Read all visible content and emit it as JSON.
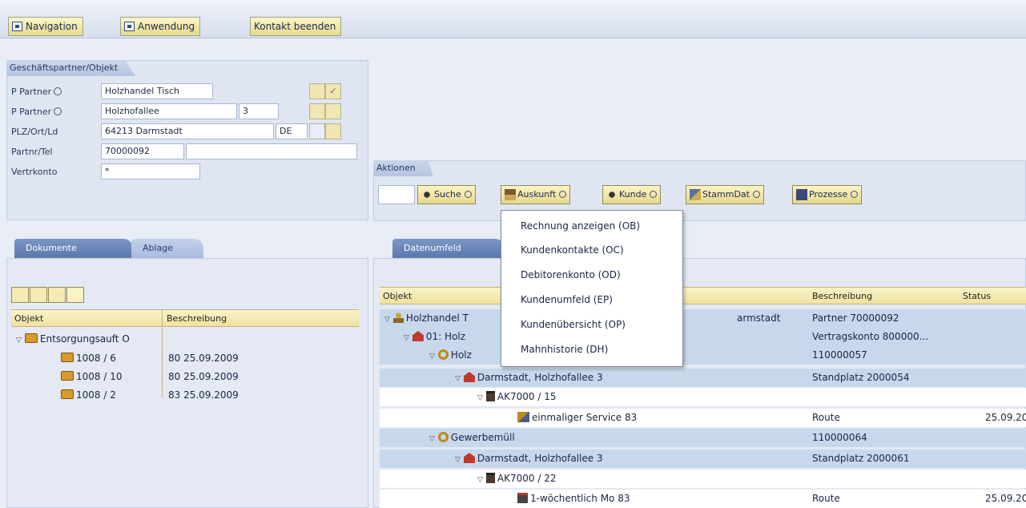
{
  "toolbar": {
    "buttons": [
      "Navigation",
      "Anwendung",
      "Kontakt beenden"
    ]
  },
  "partner_panel": {
    "title": "Geschäftspartner/Objekt",
    "rows": [
      {
        "label": "P Partner",
        "value": "Holzhandel Tisch"
      },
      {
        "label": "P Partner",
        "value": "Holzhofallee",
        "value2": "3"
      },
      {
        "label": "PLZ/Ort/Ld",
        "value": "64213 Darmstadt",
        "value2": "DE"
      },
      {
        "label": "Partnr/Tel",
        "value": "70000092",
        "value2": ""
      },
      {
        "label": "Vertrkonto",
        "value": "*"
      }
    ]
  },
  "actions": {
    "title": "Aktionen",
    "buttons": [
      "Suche",
      "Auskunft",
      "Kunde",
      "StammDat",
      "Prozesse"
    ]
  },
  "auskunft_menu": {
    "items": [
      "Rechnung anzeigen (OB)",
      "Kundenkontakte (OC)",
      "Debitorenkonto (OD)",
      "Kundenumfeld (EP)",
      "Kundenübersicht (OP)",
      "Mahnhistorie (DH)"
    ]
  },
  "left_tabs": [
    "Dokumente",
    "Ablage"
  ],
  "right_tabs": [
    "Datenumfeld"
  ],
  "documents": {
    "columns": [
      "Objekt",
      "Beschreibung"
    ],
    "rows": [
      {
        "obj": "Entsorgungsauft",
        "desc": "O",
        "level": 0,
        "expand": true
      },
      {
        "obj": "1008 / 6",
        "desc": "80 25.09.2009",
        "level": 1
      },
      {
        "obj": "1008 / 10",
        "desc": "80 25.09.2009",
        "level": 1
      },
      {
        "obj": "1008 / 2",
        "desc": "83 25.09.2009",
        "level": 1
      }
    ]
  },
  "datenumfeld": {
    "columns": [
      "Objekt",
      "Beschreibung",
      "Status"
    ],
    "rows": [
      {
        "obj": "Holzhandel T",
        "obj_tail": "armstadt",
        "desc": "Partner 70000092",
        "status": "",
        "level": 0,
        "icon": "person",
        "hl": true
      },
      {
        "obj": "01: Holz",
        "desc": "Vertragskonto 800000...",
        "status": "",
        "level": 1,
        "icon": "house",
        "hl": true
      },
      {
        "obj": "Holz",
        "desc": "110000057",
        "status": "",
        "level": 2,
        "icon": "gear",
        "hl": true
      },
      {
        "obj": "Darmstadt, Holzhofallee 3",
        "desc": "Standplatz 2000054",
        "status": "",
        "level": 3,
        "icon": "house",
        "hl": true
      },
      {
        "obj": "AK7000 / 15",
        "desc": "",
        "status": "",
        "level": 4,
        "icon": "bin",
        "hl": false
      },
      {
        "obj": "einmaliger Service 83",
        "desc": "Route",
        "status": "25.09.20",
        "level": 5,
        "icon": "svc",
        "hl": false
      },
      {
        "obj": "Gewerbemüll",
        "desc": "110000064",
        "status": "",
        "level": 2,
        "icon": "gear",
        "hl": true
      },
      {
        "obj": "Darmstadt, Holzhofallee 3",
        "desc": "Standplatz 2000061",
        "status": "",
        "level": 3,
        "icon": "house",
        "hl": true
      },
      {
        "obj": "AK7000 / 22",
        "desc": "",
        "status": "",
        "level": 4,
        "icon": "bin",
        "hl": false
      },
      {
        "obj": "1-wöchentlich Mo 83",
        "desc": "Route",
        "status": "25.09.20",
        "level": 5,
        "icon": "cal",
        "hl": false
      }
    ]
  }
}
